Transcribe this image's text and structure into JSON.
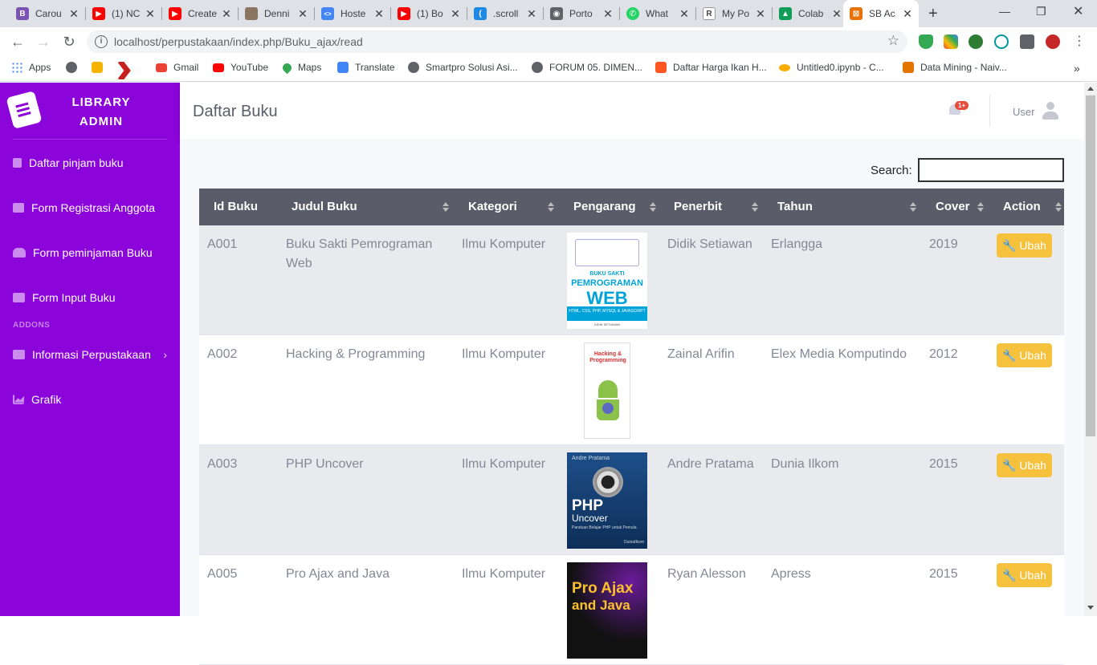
{
  "browser": {
    "tabs": [
      {
        "title": "Carou",
        "color": "#7952b3",
        "glyph": "B"
      },
      {
        "title": "(1) NC",
        "color": "#ff0000",
        "glyph": "▶"
      },
      {
        "title": "Create",
        "color": "#ff0000",
        "glyph": "▶"
      },
      {
        "title": "Denni",
        "color": "#8a7560",
        "glyph": ""
      },
      {
        "title": "Hoste",
        "color": "#4285f4",
        "glyph": "<>"
      },
      {
        "title": "(1) Bo",
        "color": "#ff0000",
        "glyph": "▶"
      },
      {
        "title": ".scroll",
        "color": "#1e88e5",
        "glyph": "("
      },
      {
        "title": "Porto",
        "color": "#5f6368",
        "glyph": "◉"
      },
      {
        "title": "What",
        "color": "#25d366",
        "glyph": "✆"
      },
      {
        "title": "My Po",
        "color": "#444444",
        "glyph": "R"
      },
      {
        "title": "Colab",
        "color": "#0f9d58",
        "glyph": "▲"
      },
      {
        "title": "SB Ac",
        "color": "#e8710a",
        "glyph": "⊠"
      }
    ],
    "url_host": "localhost",
    "url_path": "/perpustakaan/index.php/Buku_ajax/read",
    "bookmarks": [
      {
        "label": "Apps",
        "color": "#4285f4"
      },
      {
        "label": "",
        "color": "#5f6368"
      },
      {
        "label": "",
        "color": "#f4b400"
      },
      {
        "label": "",
        "color": "#c5221f"
      },
      {
        "label": "Gmail",
        "color": "#ea4335"
      },
      {
        "label": "YouTube",
        "color": "#ff0000"
      },
      {
        "label": "Maps",
        "color": "#34a853"
      },
      {
        "label": "Translate",
        "color": "#4285f4"
      },
      {
        "label": "Smartpro Solusi Asi...",
        "color": "#5f6368"
      },
      {
        "label": "FORUM 05. DIMEN...",
        "color": "#5f6368"
      },
      {
        "label": "Daftar Harga Ikan H...",
        "color": "#ff5722"
      },
      {
        "label": "Untitled0.ipynb - C...",
        "color": "#f9ab00"
      },
      {
        "label": "Data Mining - Naiv...",
        "color": "#e37400"
      }
    ]
  },
  "sidebar": {
    "brand_line1": "LIBRARY",
    "brand_line2": "ADMIN",
    "items": [
      {
        "label": "Daftar pinjam buku"
      },
      {
        "label": "Form Registrasi Anggota"
      },
      {
        "label": "Form peminjaman Buku"
      },
      {
        "label": "Form Input Buku"
      },
      {
        "label": "Informasi Perpustakaan"
      },
      {
        "label": "Grafik"
      }
    ],
    "heading": "ADDONS"
  },
  "topbar": {
    "page_title": "Daftar Buku",
    "badge": "1+",
    "user_name": "User"
  },
  "table": {
    "search_label": "Search:",
    "search_value": "",
    "columns": [
      "Id Buku",
      "Judul Buku",
      "Kategori",
      "Pengarang",
      "Penerbit",
      "Tahun",
      "Cover",
      "Action"
    ],
    "action_label": "Ubah",
    "rows": [
      {
        "id": "A001",
        "judul1": "Buku Sakti Pemrograman",
        "judul2": "Web",
        "kategori": "Ilmu Komputer",
        "pengarang": "Didik Setiawan",
        "penerbit": "Erlangga",
        "tahun": "2019"
      },
      {
        "id": "A002",
        "judul1": "Hacking & Programming",
        "judul2": "",
        "kategori": "Ilmu Komputer",
        "pengarang": "Zainal Arifin",
        "penerbit": "Elex Media Komputindo",
        "tahun": "2012"
      },
      {
        "id": "A003",
        "judul1": "PHP Uncover",
        "judul2": "",
        "kategori": "Ilmu Komputer",
        "pengarang": "Andre Pratama",
        "penerbit": "Dunia Ilkom",
        "tahun": "2015"
      },
      {
        "id": "A005",
        "judul1": "Pro Ajax and Java",
        "judul2": "",
        "kategori": "Ilmu Komputer",
        "pengarang": "Ryan Alesson",
        "penerbit": "Apress",
        "tahun": "2015"
      }
    ],
    "covers": [
      {
        "line1": "BUKU SAKTI",
        "line2": "PEMROGRAMAN",
        "line3": "WEB",
        "sub": "HTML, CSS, PHP, MYSQL & JAVASCRIPT",
        "author": "DIDIK SETIAWAN"
      },
      {
        "line1": "Hacking &",
        "line2": "Programming",
        "line3": "",
        "sub": "",
        "author": ""
      },
      {
        "line1": "Andre Pratama",
        "line2": "PHP",
        "line3": "Uncover",
        "sub": "Panduan Belajar PHP untuk Pemula",
        "author": "DuniaIlkom"
      },
      {
        "line1": "Pro Ajax",
        "line2": "and Java",
        "line3": "",
        "sub": "",
        "author": ""
      }
    ]
  },
  "colors": {
    "sidebar": "#8b04d9",
    "table_header": "#5a5c69",
    "button_warning": "#f6c23e",
    "badge": "#e74a3b"
  }
}
